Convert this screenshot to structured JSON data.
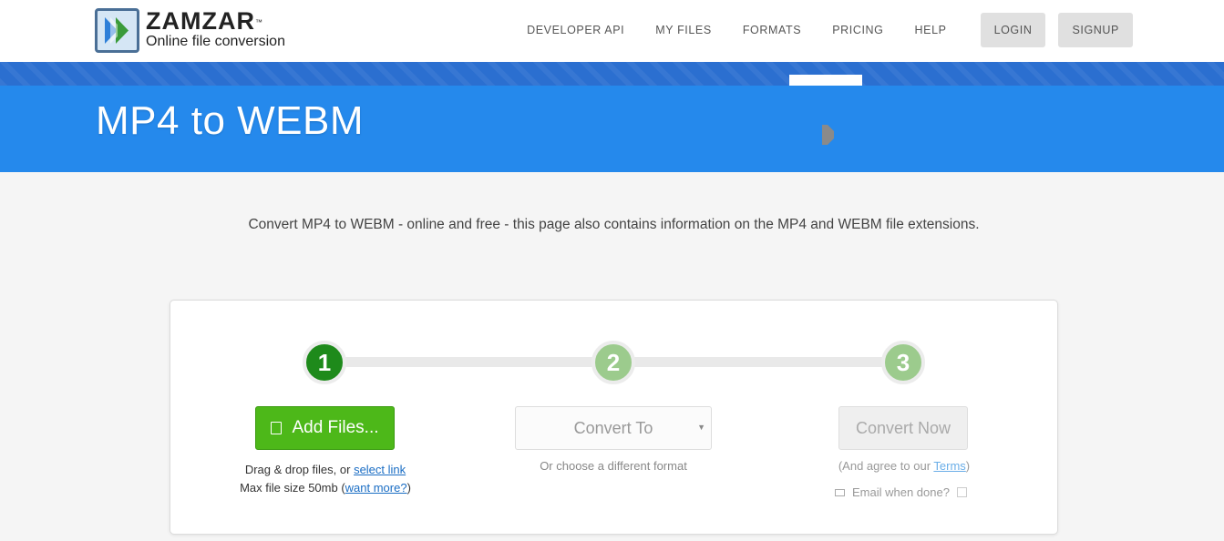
{
  "header": {
    "logo_name": "ZAMZAR",
    "logo_tm": "™",
    "logo_tagline": "Online file conversion",
    "nav": [
      "DEVELOPER API",
      "MY FILES",
      "FORMATS",
      "PRICING",
      "HELP"
    ],
    "login": "LOGIN",
    "signup": "SIGNUP"
  },
  "banner": {
    "title_a": "MP4",
    "title_b": "to",
    "title_c": "WEBM"
  },
  "intro": "Convert MP4 to WEBM - online and free - this page also contains information on the MP4 and WEBM file extensions.",
  "steps": {
    "labels": [
      "1",
      "2",
      "3"
    ],
    "add_files": "Add Files...",
    "drag_text": "Drag & drop files, or ",
    "select_link": "select link",
    "max_size": "Max file size 50mb (",
    "want_more": "want more?",
    "max_close": ")",
    "convert_to_placeholder": "Convert To",
    "choose_format": "Or choose a different format",
    "convert_now": "Convert Now",
    "agree_text": "(And agree to our ",
    "terms_link": "Terms",
    "agree_close": ")",
    "email_done": "Email when done?"
  },
  "colors": {
    "banner_blue": "#2589ec",
    "step_active": "#1e8a1b",
    "step_inactive": "#9ccb8d",
    "add_button": "#4db819"
  },
  "icons": {
    "logo": "zamzar-logo-icon",
    "add": "file-add-icon",
    "dropdown": "dropdown-caret-icon",
    "email": "envelope-icon"
  }
}
